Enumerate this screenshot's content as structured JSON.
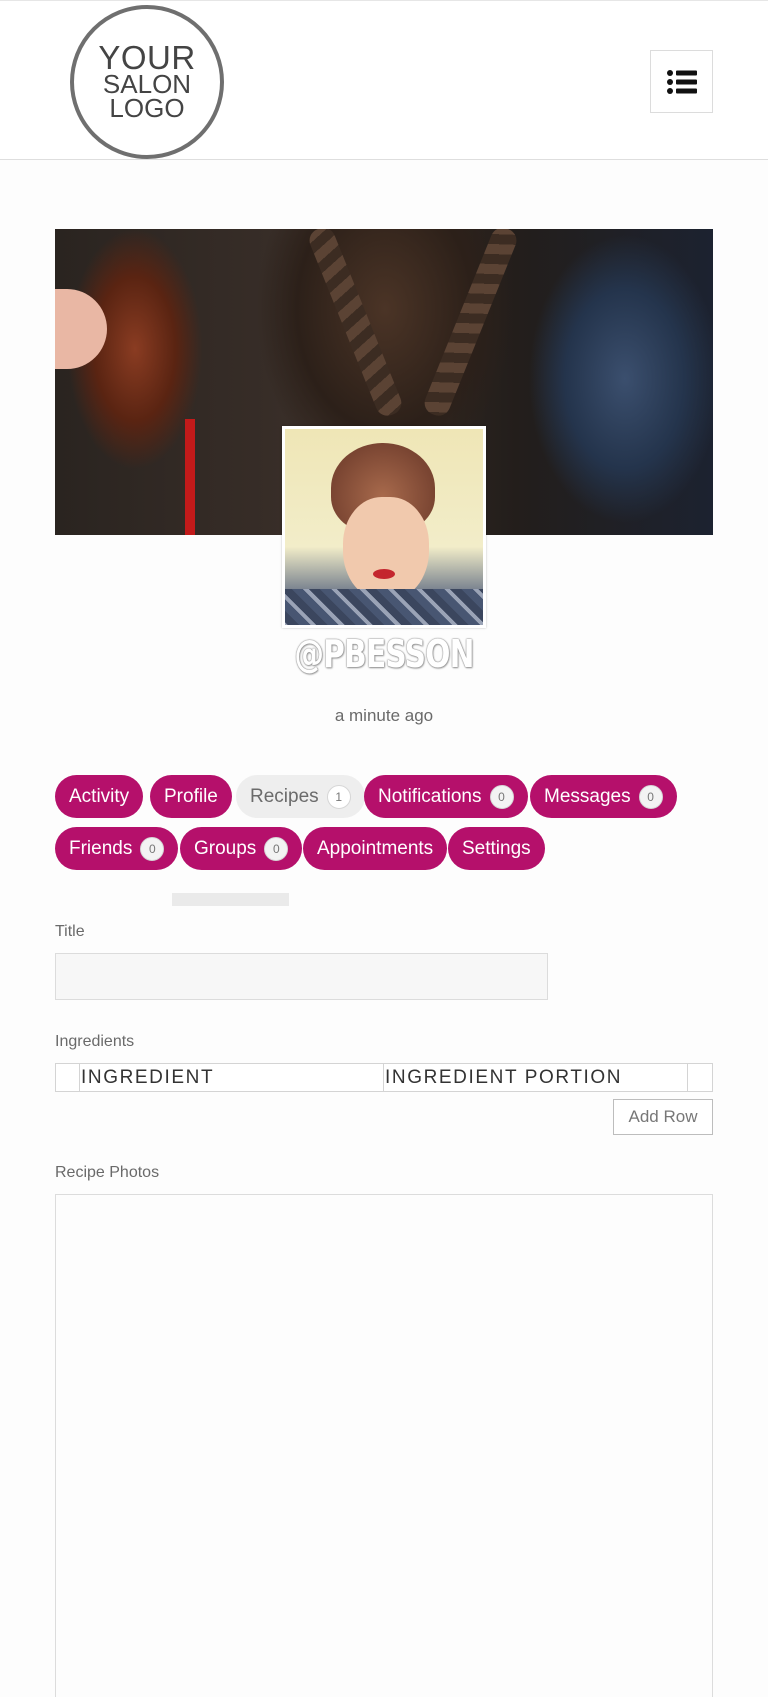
{
  "header": {
    "logo_lines": [
      "YOUR",
      "SALON",
      "LOGO"
    ],
    "menu_icon": "list-menu-icon"
  },
  "profile": {
    "username": "@PBESSON",
    "last_active": "a minute ago"
  },
  "tabs": [
    {
      "label": "Activity",
      "badge": null,
      "active": false
    },
    {
      "label": "Profile",
      "badge": null,
      "active": false
    },
    {
      "label": "Recipes",
      "badge": "1",
      "active": true
    },
    {
      "label": "Notifications",
      "badge": "0",
      "active": false
    },
    {
      "label": "Messages",
      "badge": "0",
      "active": false
    },
    {
      "label": "Friends",
      "badge": "0",
      "active": false
    },
    {
      "label": "Groups",
      "badge": "0",
      "active": false
    },
    {
      "label": "Appointments",
      "badge": null,
      "active": false
    },
    {
      "label": "Settings",
      "badge": null,
      "active": false
    }
  ],
  "form": {
    "title_label": "Title",
    "title_value": "",
    "ingredients_label": "Ingredients",
    "ingredient_col": "INGREDIENT",
    "portion_col": "INGREDIENT PORTION",
    "add_row_label": "Add Row",
    "photos_label": "Recipe Photos"
  },
  "colors": {
    "accent": "#b5106b",
    "active_tab": "#eeeeee"
  }
}
